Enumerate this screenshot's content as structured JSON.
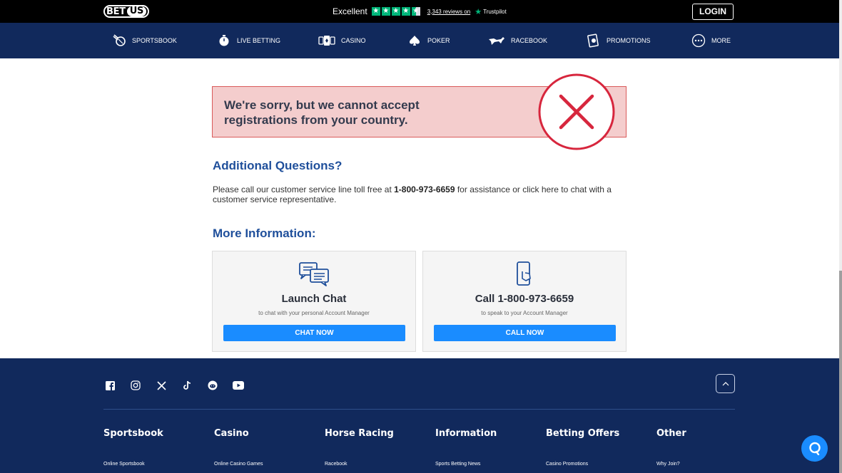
{
  "header": {
    "logo_text": "BETUS",
    "trustpilot": {
      "rating_label": "Excellent",
      "reviews_text": "3,343 reviews on",
      "brand": "Trustpilot",
      "star_color": "#00b67a"
    },
    "login_label": "LOGIN"
  },
  "nav": {
    "items": [
      {
        "label": "SPORTSBOOK",
        "icon": "sportsbook-icon"
      },
      {
        "label": "LIVE BETTING",
        "icon": "stopwatch-icon"
      },
      {
        "label": "CASINO",
        "icon": "cards-icon"
      },
      {
        "label": "POKER",
        "icon": "spade-icon"
      },
      {
        "label": "RACEBOOK",
        "icon": "horse-icon"
      },
      {
        "label": "PROMOTIONS",
        "icon": "promo-icon"
      },
      {
        "label": "MORE",
        "icon": "more-dots-icon"
      }
    ]
  },
  "main": {
    "alert_text": "We're sorry, but we cannot accept registrations from your country.",
    "additional_title": "Additional Questions?",
    "additional_text_before": "Please call our customer service line toll free at ",
    "additional_phone": "1-800-973-6659",
    "additional_text_after": " for assistance or click here to chat with a customer service representative.",
    "more_info_title": "More Information:",
    "cards": [
      {
        "title": "Launch Chat",
        "subtitle": "to chat with your personal Account Manager",
        "button": "CHAT NOW",
        "icon": "chat-icon"
      },
      {
        "title": "Call 1-800-973-6659",
        "subtitle": "to speak to your Account Manager",
        "button": "CALL NOW",
        "icon": "phone-icon"
      }
    ]
  },
  "footer": {
    "social": [
      "facebook-icon",
      "instagram-icon",
      "x-icon",
      "tiktok-icon",
      "reddit-icon",
      "youtube-icon"
    ],
    "columns": [
      {
        "heading": "Sportsbook",
        "first_link": "Online Sportsbook"
      },
      {
        "heading": "Casino",
        "first_link": "Online Casino Games"
      },
      {
        "heading": "Horse Racing",
        "first_link": "Racebook"
      },
      {
        "heading": "Information",
        "first_link": "Sports Betting News"
      },
      {
        "heading": "Betting Offers",
        "first_link": "Casino Promotions"
      },
      {
        "heading": "Other",
        "first_link": "Why Join?"
      }
    ]
  },
  "colors": {
    "nav_bg": "#11295c",
    "accent_blue": "#1a8cff",
    "heading_blue": "#1f4f9b",
    "alert_bg": "#f4cdcd",
    "alert_x_red": "#d7263d"
  }
}
